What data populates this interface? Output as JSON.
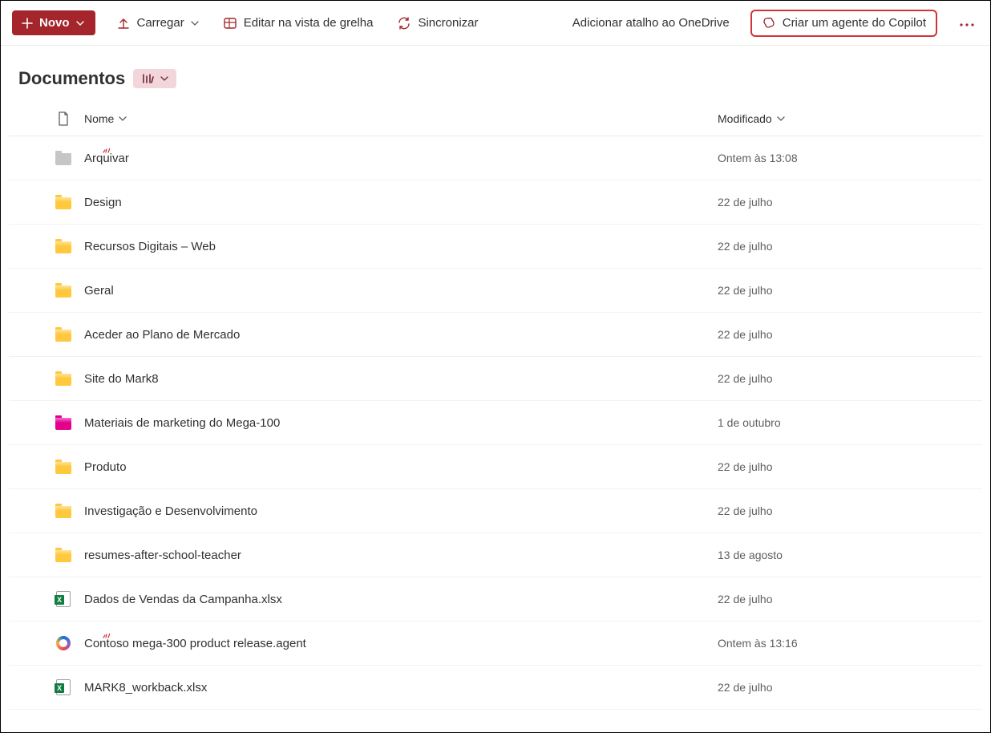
{
  "toolbar": {
    "new_label": "Novo",
    "upload_label": "Carregar",
    "edit_grid_label": "Editar na vista de grelha",
    "sync_label": "Sincronizar",
    "add_shortcut_label": "Adicionar atalho ao OneDrive",
    "copilot_label": "Criar um agente do Copilot"
  },
  "heading": {
    "title": "Documentos"
  },
  "columns": {
    "name": "Nome",
    "modified": "Modificado"
  },
  "rows": [
    {
      "icon": "folder-gray",
      "name": "Arquivar",
      "modified": "Ontem às 13:08",
      "new_badge": true
    },
    {
      "icon": "folder-yellow",
      "name": "Design",
      "modified": "22 de julho"
    },
    {
      "icon": "folder-yellow",
      "name": "Recursos Digitais – Web",
      "modified": "22 de julho"
    },
    {
      "icon": "folder-yellow",
      "name": "Geral",
      "modified": "22 de julho"
    },
    {
      "icon": "folder-yellow",
      "name": "Aceder ao Plano de Mercado",
      "modified": "22 de julho"
    },
    {
      "icon": "folder-yellow",
      "name": "Site do Mark8",
      "modified": "22 de julho"
    },
    {
      "icon": "folder-pink",
      "name": "Materiais de marketing do Mega-100",
      "modified": "1 de outubro"
    },
    {
      "icon": "folder-yellow",
      "name": "Produto",
      "modified": "22 de julho"
    },
    {
      "icon": "folder-yellow",
      "name": "Investigação e Desenvolvimento",
      "modified": "22 de julho"
    },
    {
      "icon": "folder-yellow",
      "name": "resumes-after-school-teacher",
      "modified": "13 de agosto"
    },
    {
      "icon": "excel",
      "name": "Dados de Vendas da Campanha.xlsx",
      "modified": "22 de julho"
    },
    {
      "icon": "copilot",
      "name": "Contoso mega-300 product release.agent",
      "modified": "Ontem às 13:16",
      "new_badge": true
    },
    {
      "icon": "excel",
      "name": "MARK8_workback.xlsx",
      "modified": "22 de julho"
    }
  ]
}
